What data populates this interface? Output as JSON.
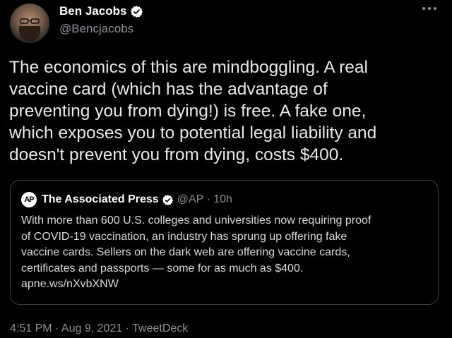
{
  "author": {
    "name": "Ben Jacobs",
    "handle": "@Bencjacobs"
  },
  "tweet": {
    "text": "The economics of this are mindboggling. A real\nvaccine card (which has the advantage of\npreventing you from dying!) is free. A fake one,\nwhich exposes you to potential legal liability and\ndoesn't prevent you from dying, costs $400."
  },
  "quote": {
    "logo_text": "AP",
    "name": "The Associated Press",
    "meta": "@AP · 10h",
    "text": "With more than 600 U.S. colleges and universities now requiring proof\nof COVID-19 vaccination, an industry has sprung up offering fake\nvaccine cards. Sellers on the dark web are offering vaccine cards,\ncertificates and passports — some for as much as $400.\napne.ws/nXvbXNW"
  },
  "footer": {
    "timestamp": "4:51 PM · Aug 9, 2021 · TweetDeck"
  },
  "colors": {
    "background": "#000000",
    "verified": "#ffffff",
    "muted": "#8b8f94"
  },
  "icons": {
    "verified": "verified-badge-icon",
    "more": "more-options-icon"
  }
}
